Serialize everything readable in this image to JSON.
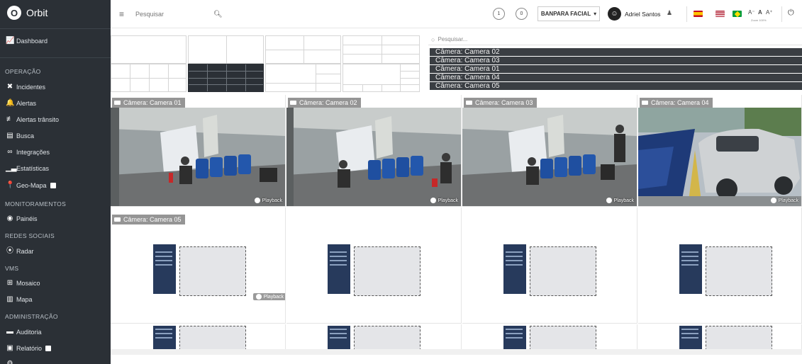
{
  "app": {
    "name": "Orbit"
  },
  "sidebar": {
    "dashboard": "Dashboard",
    "sections": [
      {
        "title": "OPERAÇÃO",
        "items": [
          {
            "label": "Incidentes",
            "icon": "x-circle-icon"
          },
          {
            "label": "Alertas",
            "icon": "bell-icon"
          },
          {
            "label": "Alertas trânsito",
            "icon": "traffic-icon"
          },
          {
            "label": "Busca",
            "icon": "clipboard-icon"
          },
          {
            "label": "Integrações",
            "icon": "link-icon"
          },
          {
            "label": "Estatísticas",
            "icon": "bar-chart-icon"
          },
          {
            "label": "Geo-Mapa",
            "icon": "map-pin-icon"
          }
        ]
      },
      {
        "title": "MONITORAMENTOS",
        "items": [
          {
            "label": "Painéis",
            "icon": "eye-icon"
          }
        ]
      },
      {
        "title": "REDES SOCIAIS",
        "items": [
          {
            "label": "Radar",
            "icon": "rss-icon"
          }
        ]
      },
      {
        "title": "VMS",
        "items": [
          {
            "label": "Mosaico",
            "icon": "mosaic-icon"
          },
          {
            "label": "Mapa",
            "icon": "map-icon"
          }
        ]
      },
      {
        "title": "ADMINISTRAÇÃO",
        "items": [
          {
            "label": "Auditoria",
            "icon": "folder-icon"
          },
          {
            "label": "Relatório",
            "icon": "file-icon"
          }
        ]
      }
    ]
  },
  "topbar": {
    "search_placeholder": "Pesquisar",
    "counter_1": "1",
    "counter_2": "0",
    "group_select": "BANPARA FACIAL",
    "user_initial": "●",
    "user_name": "Adriel Santos",
    "font_decrease": "A⁻",
    "font_normal": "A",
    "font_increase": "A⁺",
    "zoom_label": "Zoom 100%"
  },
  "colors": {
    "sidebar_bg": "#2b3036",
    "camera_option_bg": "#3a3e43",
    "placeholder_tower": "#273a5c"
  },
  "camera_panel": {
    "search_placeholder": "Pesquisar...",
    "options": [
      "Câmera: Camera 02",
      "Câmera: Camera 03",
      "Câmera: Camera 01",
      "Câmera: Camera 04",
      "Câmera: Camera 05"
    ]
  },
  "grid": {
    "tiles": [
      {
        "label": "Câmera: Camera 01",
        "playback": "Playback"
      },
      {
        "label": "Câmera: Camera 02",
        "playback": "Playback"
      },
      {
        "label": "Câmera: Camera 03",
        "playback": "Playback"
      },
      {
        "label": "Câmera: Camera 04",
        "playback": "Playback"
      },
      {
        "label": "Câmera: Camera 05",
        "playback": "Playback"
      }
    ]
  }
}
